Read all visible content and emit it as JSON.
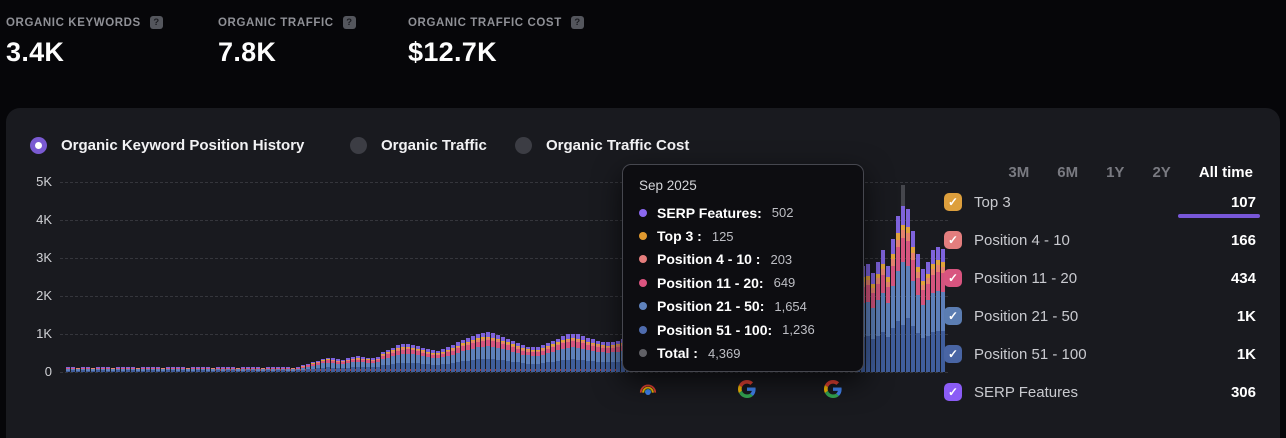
{
  "stats": [
    {
      "label": "ORGANIC KEYWORDS",
      "value": "3.4K",
      "help_icon": "question-mark-icon"
    },
    {
      "label": "ORGANIC TRAFFIC",
      "value": "7.8K",
      "help_icon": "question-mark-icon"
    },
    {
      "label": "ORGANIC TRAFFIC COST",
      "value": "$12.7K",
      "help_icon": "question-mark-icon"
    }
  ],
  "chart_tabs": [
    {
      "label": "Organic Keyword Position History",
      "selected": true
    },
    {
      "label": "Organic Traffic",
      "selected": false
    },
    {
      "label": "Organic Traffic Cost",
      "selected": false
    }
  ],
  "time_ranges": [
    {
      "label": "3M",
      "selected": false
    },
    {
      "label": "6M",
      "selected": false
    },
    {
      "label": "1Y",
      "selected": false
    },
    {
      "label": "2Y",
      "selected": false
    },
    {
      "label": "All time",
      "selected": true
    }
  ],
  "legend": [
    {
      "label": "Top 3",
      "value": "107",
      "color": "#dd9f3d",
      "checked": true
    },
    {
      "label": "Position 4 - 10",
      "value": "166",
      "color": "#e37e7e",
      "checked": true
    },
    {
      "label": "Position 11 - 20",
      "value": "434",
      "color": "#d8547f",
      "checked": true
    },
    {
      "label": "Position 21 - 50",
      "value": "1K",
      "color": "#5b7db2",
      "checked": true
    },
    {
      "label": "Position 51 - 100",
      "value": "1K",
      "color": "#4965a4",
      "checked": true
    },
    {
      "label": "SERP Features",
      "value": "306",
      "color": "#8b5cf6",
      "checked": true
    }
  ],
  "tooltip": {
    "date": "Sep 2025",
    "rows": [
      {
        "label": "SERP Features:",
        "value": "502",
        "color": "#8b68f0"
      },
      {
        "label": "Top 3 :",
        "value": "125",
        "color": "#e0992f"
      },
      {
        "label": "Position 4 - 10 :",
        "value": "203",
        "color": "#e57d7d"
      },
      {
        "label": "Position 11 - 20:",
        "value": "649",
        "color": "#db5480"
      },
      {
        "label": "Position 21 - 50:",
        "value": "1,654",
        "color": "#5f82bd"
      },
      {
        "label": "Position 51 - 100:",
        "value": "1,236",
        "color": "#4f6cae"
      },
      {
        "label": "Total :",
        "value": "4,369",
        "color": "#606066"
      }
    ]
  },
  "chart_data": {
    "type": "bar",
    "stacked": true,
    "title": "Organic Keyword Position History",
    "xlabel": "",
    "ylabel": "",
    "y_ticks": [
      "5K",
      "4K",
      "3K",
      "2K",
      "1K",
      "0"
    ],
    "ylim": [
      0,
      5000
    ],
    "grid": "dashed-horizontal",
    "legend_position": "right",
    "series_order_bottom_to_top": [
      "Position 51 - 100",
      "Position 21 - 50",
      "Position 11 - 20",
      "Position 4 - 10",
      "Top 3",
      "SERP Features"
    ],
    "series_colors": {
      "Position 51 - 100": "#405e9c",
      "Position 21 - 50": "#5e80ba",
      "Position 11 - 20": "#d4547e",
      "Position 4 - 10": "#e5826d",
      "Top 3": "#e0a23c",
      "SERP Features": "#7e63dc"
    },
    "stack_fractions": {
      "Position 51 - 100": 0.33,
      "Position 21 - 50": 0.32,
      "Position 11 - 20": 0.15,
      "Position 4 - 10": 0.05,
      "Top 3": 0.04,
      "SERP Features": 0.11
    },
    "bar_totals": [
      120,
      125,
      115,
      130,
      120,
      110,
      125,
      130,
      120,
      115,
      125,
      120,
      130,
      125,
      115,
      120,
      130,
      125,
      120,
      115,
      125,
      130,
      120,
      125,
      115,
      120,
      130,
      125,
      120,
      115,
      125,
      120,
      130,
      125,
      115,
      120,
      125,
      130,
      120,
      115,
      125,
      120,
      130,
      125,
      120,
      115,
      125,
      180,
      220,
      260,
      300,
      350,
      380,
      360,
      340,
      330,
      360,
      390,
      410,
      400,
      380,
      370,
      390,
      520,
      580,
      640,
      700,
      730,
      750,
      720,
      680,
      640,
      600,
      570,
      550,
      600,
      650,
      700,
      780,
      850,
      900,
      950,
      1000,
      1030,
      1050,
      1020,
      980,
      930,
      880,
      820,
      760,
      700,
      670,
      650,
      660,
      700,
      760,
      820,
      880,
      940,
      990,
      1010,
      990,
      950,
      900,
      860,
      830,
      800,
      780,
      800,
      830,
      860,
      900,
      940,
      980,
      1020,
      1060,
      1100,
      1150,
      1200,
      1250,
      1300,
      1350,
      1400,
      1450,
      1500,
      1550,
      1600,
      1650,
      1700,
      1750,
      1800,
      1850,
      1900,
      1950,
      2000,
      2050,
      2100,
      2150,
      2200,
      2250,
      2300,
      2350,
      2400,
      2450,
      2500,
      2550,
      2600,
      2580,
      2560,
      2540,
      2520,
      2500,
      2500,
      2550,
      2600,
      2650,
      2700,
      2750,
      2800,
      2850,
      2600,
      2900,
      3200,
      2800,
      3500,
      4100,
      4369,
      4300,
      3700,
      3100,
      2700,
      2900,
      3200,
      3300,
      3250
    ],
    "hover_index": 167,
    "hover_point": {
      "date": "Sep 2025",
      "SERP Features": 502,
      "Top 3": 125,
      "Position 4 - 10": 203,
      "Position 11 - 20": 649,
      "Position 21 - 50": 1654,
      "Position 51 - 100": 1236,
      "Total": 4369
    },
    "axis_markers": [
      "algorithm-update-rainbow-icon",
      "google-icon",
      "google-icon"
    ]
  },
  "colors": {
    "page_bg": "#060609",
    "card_bg": "#191a1f",
    "accent_purple": "#7a5ad2",
    "tab_underline": "#7857d8",
    "grid": "#35363c",
    "hover_column": "#45464c",
    "baseline_red": "#9e3b36"
  }
}
